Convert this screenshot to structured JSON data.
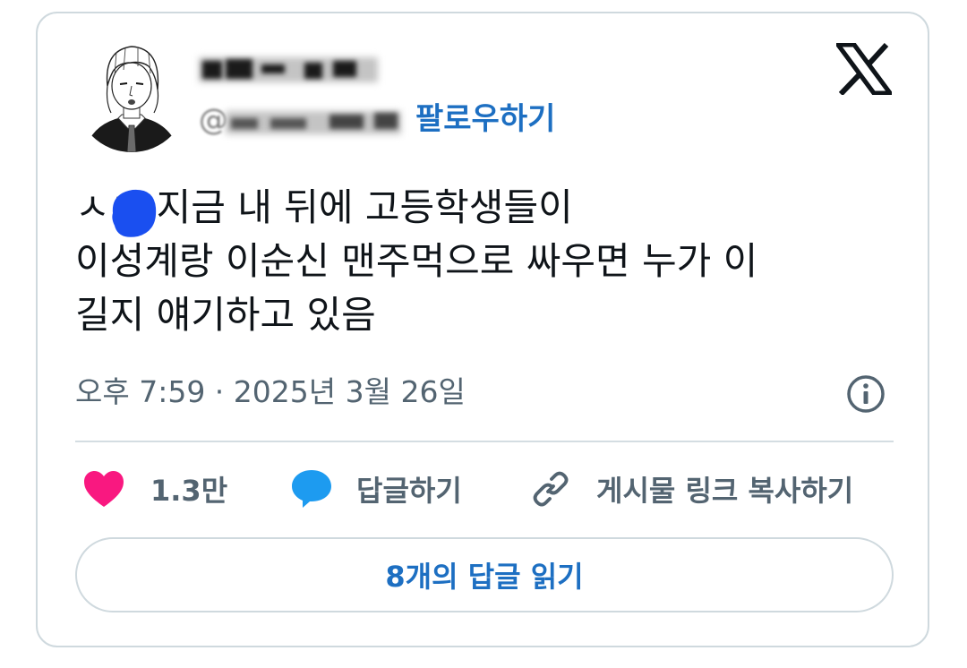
{
  "author": {
    "display_name": "",
    "handle_prefix": "@",
    "follow_label": "팔로우하기"
  },
  "tweet": {
    "lines": [
      "ㅅㅂ 지금 내 뒤에 고등학생들이",
      "이성계랑 이순신 맨주먹으로 싸우면 누가 이",
      "길지 얘기하고 있음"
    ],
    "timestamp": "오후 7:59 · 2025년 3월 26일"
  },
  "actions": {
    "like_count": "1.3만",
    "reply_label": "답글하기",
    "copy_link_label": "게시물 링크 복사하기"
  },
  "read_replies_label": "8개의 답글 읽기",
  "icons": {
    "logo": "x-logo-icon",
    "info": "info-icon",
    "like": "heart-icon",
    "reply": "speech-bubble-icon",
    "link": "link-icon"
  },
  "colors": {
    "accent": "#1d6fc2",
    "heart": "#f91880",
    "reply_bubble": "#1d9bf0",
    "muted_text": "#536471",
    "border": "#cfd9de"
  }
}
